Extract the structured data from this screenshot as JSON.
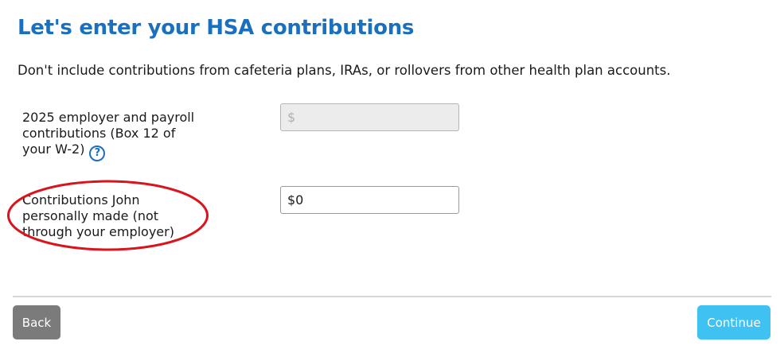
{
  "header": {
    "title": "Let's enter your HSA contributions",
    "subtitle": "Don't include contributions from cafeteria plans, IRAs, or rollovers from other health plan accounts."
  },
  "fields": {
    "employer": {
      "label": "2025 employer and payroll contributions (Box 12 of your W-2)",
      "value": "",
      "placeholder": "$",
      "help_icon": "question-circle-icon"
    },
    "personal": {
      "label": "Contributions John personally made (not through your employer)",
      "value": "$0",
      "annotation": "red-ellipse-highlight"
    }
  },
  "footer": {
    "back_label": "Back",
    "continue_label": "Continue"
  },
  "colors": {
    "title": "#1b6fbf",
    "continue_button": "#3fc1f2",
    "back_button": "#7b7b7b",
    "highlight": "#d9141d"
  }
}
